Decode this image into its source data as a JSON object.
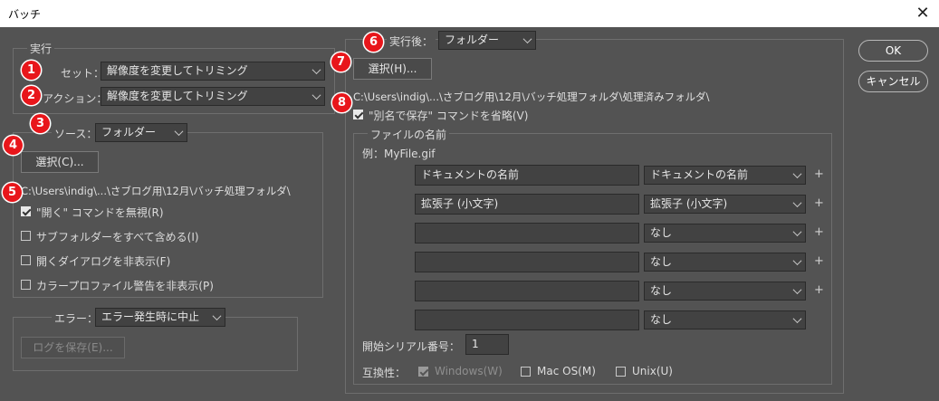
{
  "window": {
    "title": "バッチ",
    "close_label": "✕"
  },
  "play": {
    "legend": "実行",
    "set_label": "セット：",
    "set_value": "解像度を変更してトリミング",
    "action_label": "アクション：",
    "action_value": "解像度を変更してトリミング"
  },
  "source": {
    "label": "ソース：",
    "value": "フォルダー",
    "choose_label": "選択(C)...",
    "path": "C:\\Users\\indig\\...\\さブログ用\\12月\\バッチ処理フォルダ\\",
    "options": [
      {
        "label": "\"開く\" コマンドを無視(R)",
        "checked": true
      },
      {
        "label": "サブフォルダーをすべて含める(I)",
        "checked": false
      },
      {
        "label": "開くダイアログを非表示(F)",
        "checked": false
      },
      {
        "label": "カラープロファイル警告を非表示(P)",
        "checked": false
      }
    ]
  },
  "errors": {
    "label": "エラー：",
    "value": "エラー発生時に中止",
    "save_log_label": "ログを保存(E)..."
  },
  "destination": {
    "label": "実行後：",
    "value": "フォルダー",
    "choose_label": "選択(H)...",
    "path": "C:\\Users\\indig\\...\\さブログ用\\12月\\バッチ処理フォルダ\\処理済みフォルダ\\",
    "override_label": "\"別名で保存\" コマンドを省略(V)",
    "override_checked": true
  },
  "file_naming": {
    "legend": "ファイルの名前",
    "example": "例：MyFile.gif",
    "rows": [
      {
        "text": "ドキュメントの名前",
        "select": "ドキュメントの名前",
        "plus": "+"
      },
      {
        "text": "拡張子 (小文字)",
        "select": "拡張子 (小文字)",
        "plus": "+"
      },
      {
        "text": "",
        "select": "なし",
        "plus": "+"
      },
      {
        "text": "",
        "select": "なし",
        "plus": "+"
      },
      {
        "text": "",
        "select": "なし",
        "plus": "+"
      },
      {
        "text": "",
        "select": "なし",
        "plus": ""
      }
    ],
    "serial_label": "開始シリアル番号：",
    "serial_value": "1",
    "compat_label": "互換性：",
    "compat": [
      {
        "label": "Windows(W)",
        "checked": true,
        "disabled": true
      },
      {
        "label": "Mac OS(M)",
        "checked": false,
        "disabled": false
      },
      {
        "label": "Unix(U)",
        "checked": false,
        "disabled": false
      }
    ]
  },
  "buttons": {
    "ok": "OK",
    "cancel": "キャンセル"
  },
  "annotations": [
    "1",
    "2",
    "3",
    "4",
    "5",
    "6",
    "7",
    "8"
  ],
  "colors": {
    "background": "#535353",
    "badge": "#e8161b",
    "titlebar": "#ffffff"
  }
}
